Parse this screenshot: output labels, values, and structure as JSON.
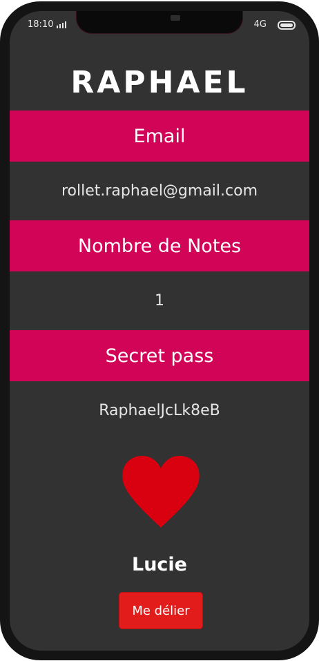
{
  "status_bar": {
    "time": "18:10",
    "network": "4G"
  },
  "profile": {
    "name": "RAPHAEL"
  },
  "sections": [
    {
      "label": "Email",
      "value": "rollet.raphael@gmail.com"
    },
    {
      "label": "Nombre de Notes",
      "value": "1"
    },
    {
      "label": "Secret pass",
      "value": "RaphaelJcLk8eB"
    }
  ],
  "partner": {
    "icon": "heart-icon",
    "heart_color": "#d9000f",
    "name": "Lucie",
    "unlink_label": "Me délier"
  },
  "colors": {
    "accent": "#d10458",
    "background": "#323232",
    "button": "#e21b1b"
  }
}
